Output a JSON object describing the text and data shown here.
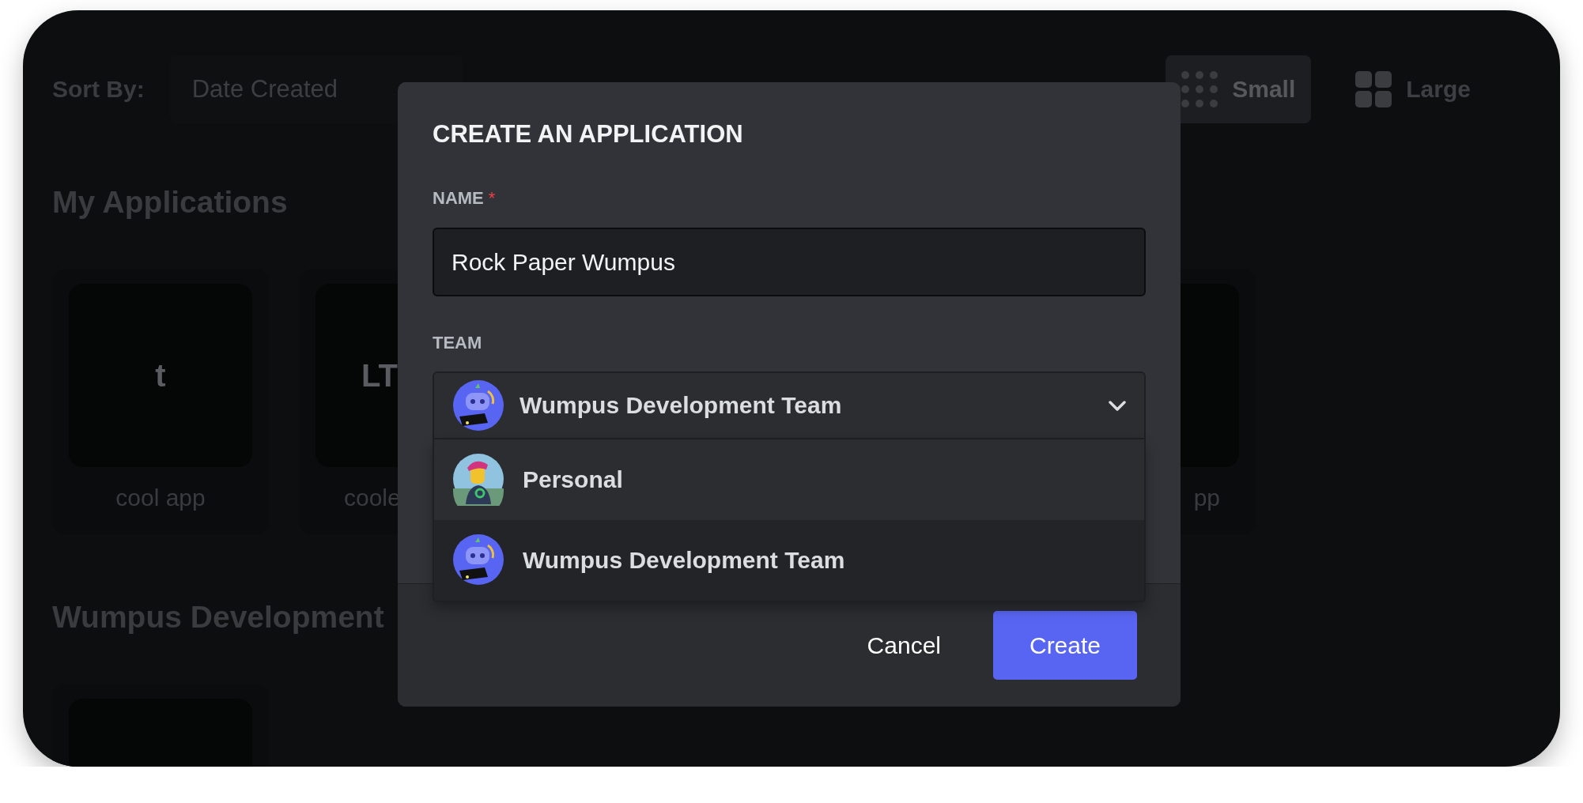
{
  "toolbar": {
    "sort_label": "Sort By:",
    "sort_value": "Date Created",
    "view_options": [
      {
        "kind": "small",
        "label": "Small",
        "selected": true
      },
      {
        "kind": "large",
        "label": "Large",
        "selected": false
      }
    ]
  },
  "sections": [
    {
      "title": "My Applications",
      "apps": [
        {
          "kind": "initials",
          "initials": "t",
          "name": "cool app"
        },
        {
          "kind": "initials",
          "initials": "LT",
          "name": "coole"
        },
        {
          "kind": "blank",
          "name": "pp"
        }
      ]
    },
    {
      "title": "Wumpus Development",
      "apps": [
        {
          "kind": "blank"
        }
      ]
    }
  ],
  "modal": {
    "title": "CREATE AN APPLICATION",
    "fields": [
      {
        "kind": "text",
        "label": "NAME",
        "required_mark": "*",
        "value": "Rock Paper Wumpus"
      },
      {
        "kind": "select",
        "label": "TEAM",
        "value": "Wumpus Development Team",
        "expanded": true,
        "options": [
          {
            "kind": "person",
            "label": "Personal",
            "selected": false
          },
          {
            "kind": "robot",
            "label": "Wumpus Development Team",
            "selected": true
          }
        ]
      }
    ],
    "buttons": [
      {
        "kind": "link",
        "label": "Cancel"
      },
      {
        "kind": "primary",
        "label": "Create"
      }
    ]
  }
}
